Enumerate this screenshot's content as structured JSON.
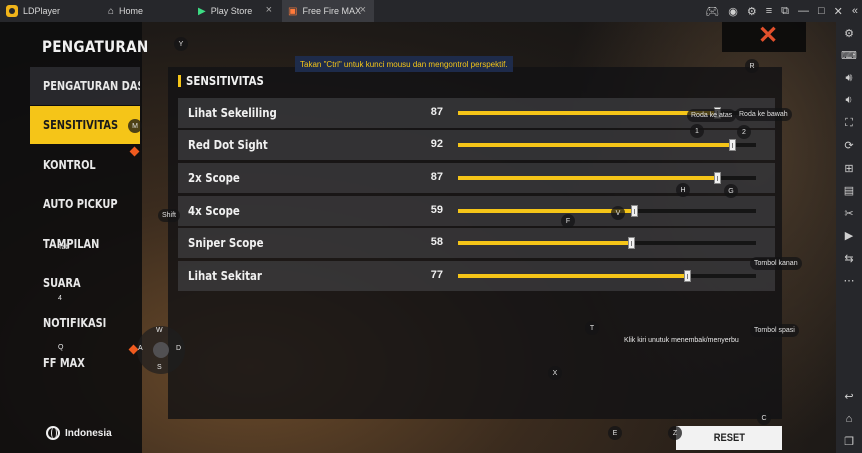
{
  "titlebar": {
    "app_name": "LDPlayer",
    "tabs": [
      {
        "label": "Home",
        "icon": "home-icon"
      },
      {
        "label": "Play Store",
        "icon": "play-store-icon"
      },
      {
        "label": "Free Fire MAX",
        "icon": "free-fire-icon",
        "active": true
      }
    ]
  },
  "hint_banner": "Takan \"Ctrl\" untuk kunci mousu dan mengontrol perspektif.",
  "settings": {
    "title": "PENGATURAN",
    "menu": [
      {
        "label": "PENGATURAN DASAR",
        "active": false
      },
      {
        "label": "SENSITIVITAS",
        "active": true
      },
      {
        "label": "KONTROL",
        "active": false
      },
      {
        "label": "AUTO PICKUP",
        "active": false
      },
      {
        "label": "TAMPILAN",
        "active": false
      },
      {
        "label": "SUARA",
        "active": false
      },
      {
        "label": "NOTIFIKASI",
        "active": false
      },
      {
        "label": "FF MAX",
        "active": false
      }
    ],
    "language": "Indonesia",
    "section_title": "SENSITIVITAS",
    "sliders": [
      {
        "label": "Lihat Sekeliling",
        "value": "87",
        "fraction": 0.87
      },
      {
        "label": "Red Dot Sight",
        "value": "92",
        "fraction": 0.92
      },
      {
        "label": "2x Scope",
        "value": "87",
        "fraction": 0.87
      },
      {
        "label": "4x Scope",
        "value": "59",
        "fraction": 0.59
      },
      {
        "label": "Sniper Scope",
        "value": "58",
        "fraction": 0.58
      },
      {
        "label": "Lihat Sekitar",
        "value": "77",
        "fraction": 0.77
      }
    ],
    "reset_label": "RESET"
  },
  "keymap": {
    "Y": "Y",
    "M": "M",
    "R": "R",
    "Shift": "Shift",
    "Tab": "Tab",
    "4": "4",
    "Q": "Q",
    "W": "W",
    "A": "A",
    "S": "S",
    "D": "D",
    "1": "1",
    "2": "2",
    "H": "H",
    "G": "G",
    "V": "V",
    "F": "F",
    "T": "T",
    "X": "X",
    "E": "E",
    "Z": "Z",
    "C": "C",
    "wheel_up": "Roda ke atas",
    "wheel_down": "Roda ke bawah",
    "right_click": "Tombol kanan",
    "space": "Tombol spasi",
    "left_click": "Klik kiri unutuk menembak/menyerbu"
  },
  "colors": {
    "accent": "#f5c518",
    "close": "#e2502c",
    "marker": "#f05a1e"
  }
}
